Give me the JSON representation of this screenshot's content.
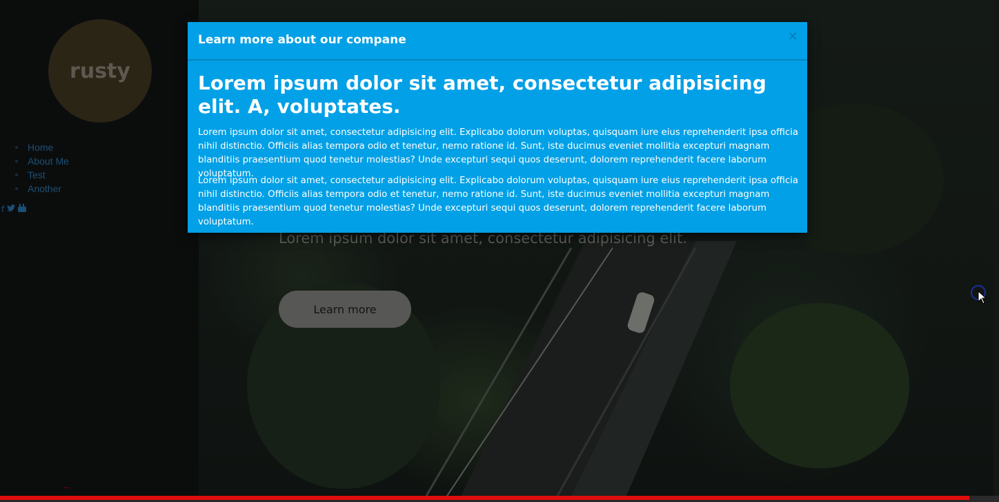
{
  "sidebar": {
    "logo_text": "rusty",
    "nav_items": [
      {
        "label": "Home"
      },
      {
        "label": "About Me"
      },
      {
        "label": "Test"
      },
      {
        "label": "Another"
      }
    ],
    "social_icons": [
      "facebook-icon",
      "twitter-icon",
      "youtube-icon"
    ],
    "social_glyphs": [
      "f",
      "🐦",
      "▶"
    ]
  },
  "hero": {
    "subtitle": "Lorem ipsum dolor sit amet, consectetur adipisicing elit.",
    "button_label": "Learn more"
  },
  "modal": {
    "title": "Learn more about our compane",
    "close_glyph": "×",
    "heading": "Lorem ipsum dolor sit amet, consectetur adipisicing elit. A, voluptates.",
    "paragraphs": [
      "Lorem ipsum dolor sit amet, consectetur adipisicing elit. Explicabo dolorum voluptas, quisquam iure eius reprehenderit ipsa officia nihil distinctio. Officiis alias tempora odio et tenetur, nemo ratione id. Sunt, iste ducimus eveniet mollitia excepturi magnam blanditiis praesentium quod tenetur molestias? Unde excepturi sequi quos deserunt, dolorem reprehenderit facere laborum voluptatum.",
      "Lorem ipsum dolor sit amet, consectetur adipisicing elit. Explicabo dolorum voluptas, quisquam iure eius reprehenderit ipsa officia nihil distinctio. Officiis alias tempora odio et tenetur, nemo ratione id. Sunt, iste ducimus eveniet mollitia excepturi magnam blanditiis praesentium quod tenetur molestias? Unde excepturi sequi quos deserunt, dolorem reprehenderit facere laborum voluptatum."
    ]
  },
  "video_progress": {
    "played_fraction": 0.97
  },
  "colors": {
    "modal_bg": "#02a0e6",
    "nav_link": "#1b4f76",
    "progress": "#e00d0d"
  }
}
